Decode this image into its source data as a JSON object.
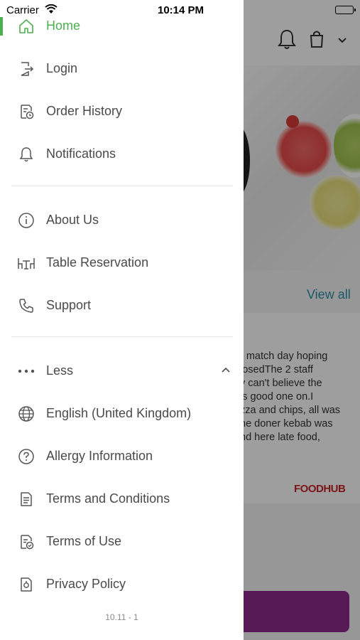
{
  "status_bar": {
    "carrier": "Carrier",
    "time": "10:14 PM"
  },
  "background": {
    "view_all": "View all",
    "review_text": "r match day hoping\nlosedThe 2 staff\ny can't believe the\nis good one on.I\nzza and chips, all was\nhe doner kebab was\nnd here late food,\n!",
    "brand": "FOODHUB"
  },
  "menu": {
    "home": "Home",
    "login": "Login",
    "order_history": "Order History",
    "notifications": "Notifications",
    "about_us": "About Us",
    "table_reservation": "Table Reservation",
    "support": "Support",
    "less": "Less",
    "language": "English (United Kingdom)",
    "allergy": "Allergy Information",
    "terms_conditions": "Terms and Conditions",
    "terms_use": "Terms of Use",
    "privacy": "Privacy Policy"
  },
  "version": "10.11 - 1",
  "colors": {
    "accent": "#4caf50",
    "link": "#2a8fa8",
    "brand": "#c8242b",
    "button": "#8e2a8c"
  }
}
